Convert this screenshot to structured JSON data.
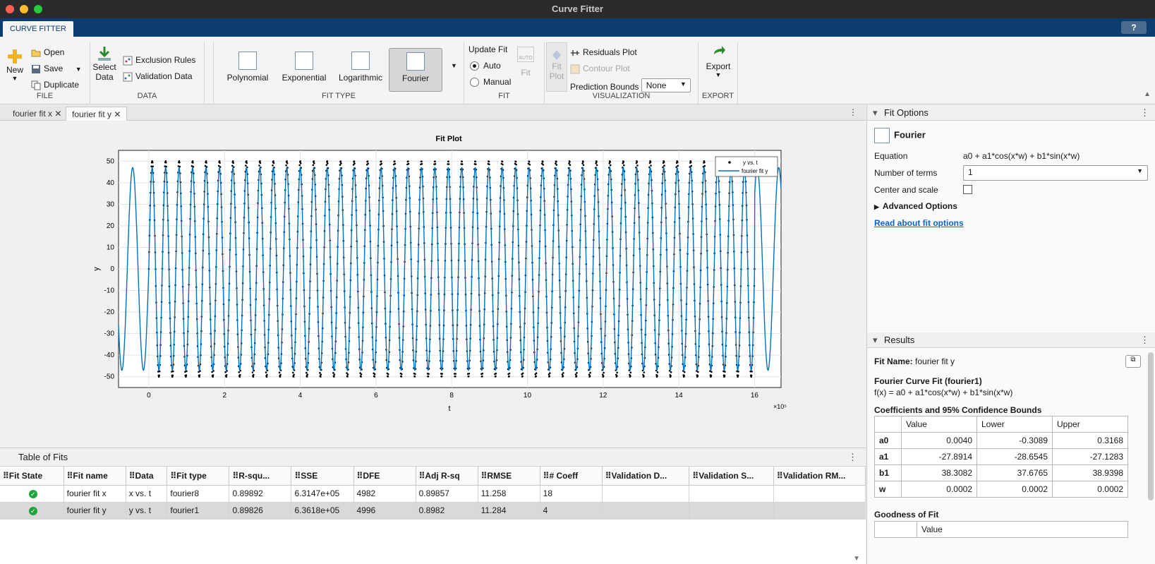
{
  "window": {
    "title": "Curve Fitter"
  },
  "toolstrip": {
    "tab": "CURVE FITTER",
    "file": {
      "label": "FILE",
      "new": "New",
      "open": "Open",
      "save": "Save",
      "duplicate": "Duplicate"
    },
    "data": {
      "label": "DATA",
      "select": [
        "Select",
        "Data"
      ],
      "exclusion": "Exclusion Rules",
      "validation": "Validation Data"
    },
    "fittype": {
      "label": "FIT TYPE",
      "items": [
        "Polynomial",
        "Exponential",
        "Logarithmic",
        "Fourier"
      ],
      "selected": "Fourier"
    },
    "fit": {
      "label": "FIT",
      "update": "Update Fit",
      "auto": "Auto",
      "manual": "Manual",
      "fit_button": "Fit",
      "auto_badge": "AUTO"
    },
    "visualization": {
      "label": "VISUALIZATION",
      "fitplot": [
        "Fit",
        "Plot"
      ],
      "residuals": "Residuals Plot",
      "contour": "Contour Plot",
      "bounds_label": "Prediction Bounds",
      "bounds_value": "None"
    },
    "export": {
      "label": "EXPORT",
      "button": "Export"
    }
  },
  "doc_tabs": [
    "fourier fit x",
    "fourier fit y"
  ],
  "active_doc_tab": 1,
  "plot": {
    "title": "Fit Plot",
    "xlabel": "t",
    "ylabel": "y",
    "exponent": "×10⁵",
    "legend": [
      "y vs. t",
      "fourier fit y"
    ]
  },
  "chart_data": {
    "type": "line",
    "title": "Fit Plot",
    "xlabel": "t",
    "ylabel": "y",
    "x_scale_label": "×10⁵",
    "xlim": [
      -0.8,
      16.7
    ],
    "ylim": [
      -55,
      55
    ],
    "xticks": [
      0,
      2,
      4,
      6,
      8,
      10,
      12,
      14,
      16
    ],
    "yticks": [
      50,
      40,
      30,
      20,
      10,
      0,
      -10,
      -20,
      -30,
      -40,
      -50
    ],
    "grid": true,
    "legend_position": "top-right",
    "series": [
      {
        "name": "y vs. t",
        "kind": "scatter",
        "x_range": [
          0,
          16
        ],
        "amplitude": 50,
        "cycles": 45,
        "color": "#000000"
      },
      {
        "name": "fourier fit y",
        "kind": "line",
        "x_range": [
          -0.8,
          16.7
        ],
        "amplitude": 47,
        "color": "#0072bd"
      }
    ]
  },
  "table_of_fits": {
    "title": "Table of Fits",
    "columns": [
      "Fit State",
      "Fit name",
      "Data",
      "Fit type",
      "R-squ...",
      "SSE",
      "DFE",
      "Adj R-sq",
      "RMSE",
      "# Coeff",
      "Validation D...",
      "Validation S...",
      "Validation RM..."
    ],
    "rows": [
      [
        "",
        "fourier fit x",
        "x vs. t",
        "fourier8",
        "0.89892",
        "6.3147e+05",
        "4982",
        "0.89857",
        "11.258",
        "18",
        "",
        "",
        ""
      ],
      [
        "",
        "fourier fit y",
        "y vs. t",
        "fourier1",
        "0.89826",
        "6.3618e+05",
        "4996",
        "0.8982",
        "11.284",
        "4",
        "",
        "",
        ""
      ]
    ],
    "selected_row": 1
  },
  "fit_options": {
    "title": "Fit Options",
    "type": "Fourier",
    "equation_label": "Equation",
    "equation": "a0 + a1*cos(x*w) + b1*sin(x*w)",
    "terms_label": "Number of terms",
    "terms_value": "1",
    "center_label": "Center and scale",
    "advanced": "Advanced Options",
    "read_link": "Read about fit options"
  },
  "results": {
    "title": "Results",
    "fit_name_label": "Fit Name:",
    "fit_name": "fourier fit y",
    "curve_title": "Fourier Curve Fit (fourier1)",
    "formula": "f(x) = a0 + a1*cos(x*w) + b1*sin(x*w)",
    "coef_title": "Coefficients and 95% Confidence Bounds",
    "coef_columns": [
      "",
      "Value",
      "Lower",
      "Upper"
    ],
    "coefficients": [
      [
        "a0",
        "0.0040",
        "-0.3089",
        "0.3168"
      ],
      [
        "a1",
        "-27.8914",
        "-28.6545",
        "-27.1283"
      ],
      [
        "b1",
        "38.3082",
        "37.6765",
        "38.9398"
      ],
      [
        "w",
        "0.0002",
        "0.0002",
        "0.0002"
      ]
    ],
    "gof_title": "Goodness of Fit",
    "gof_columns": [
      "",
      "Value"
    ]
  }
}
